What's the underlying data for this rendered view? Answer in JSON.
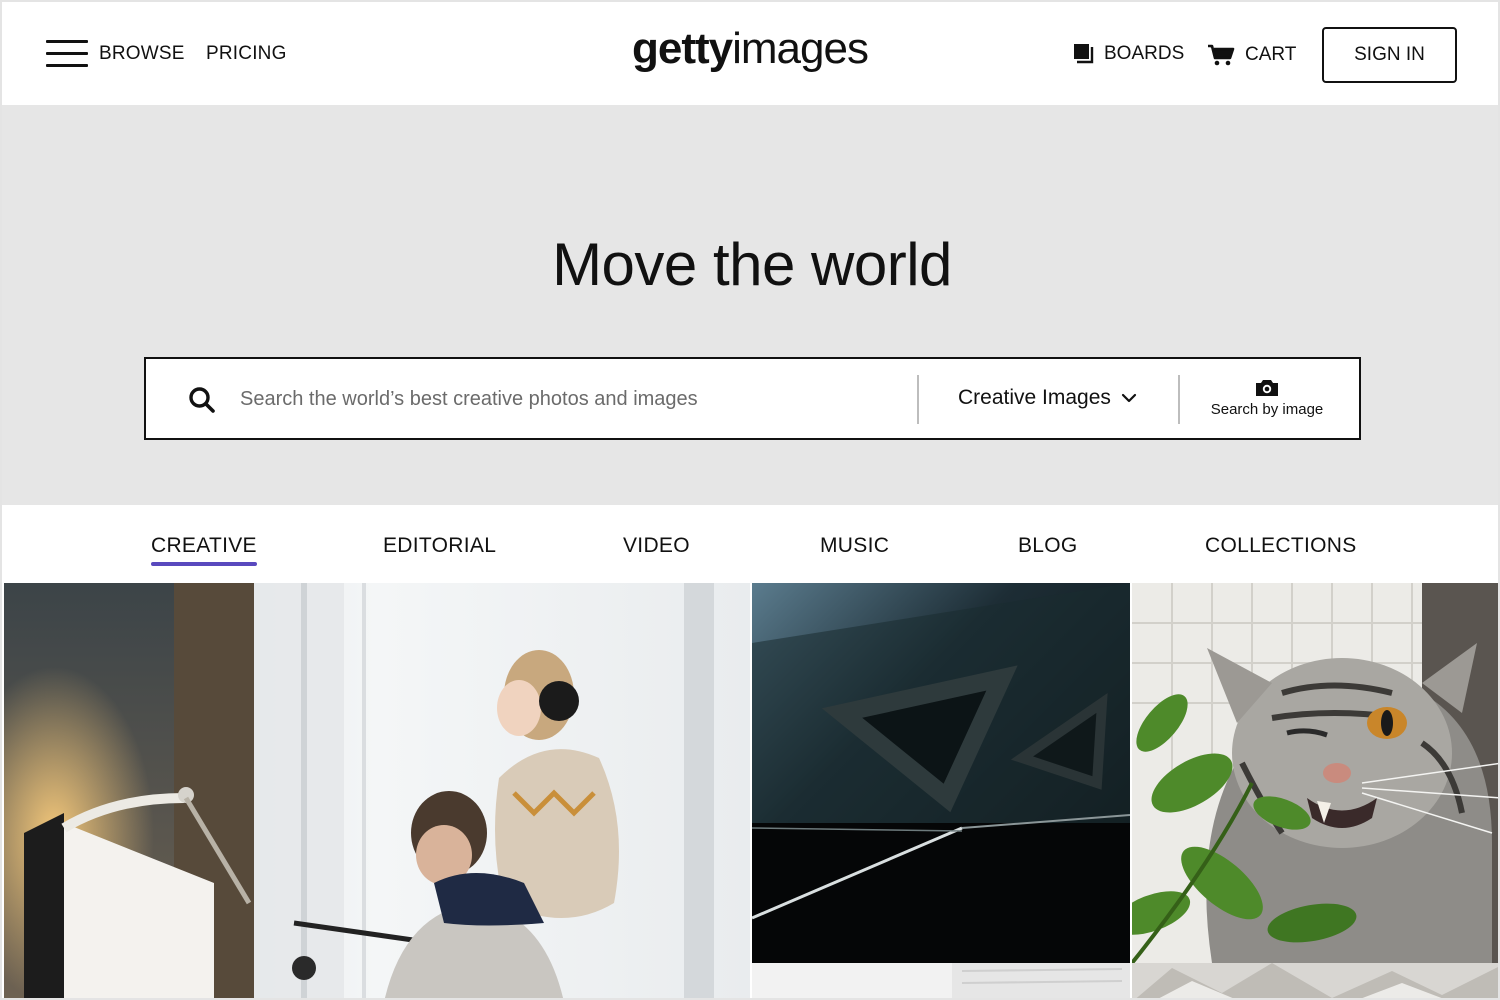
{
  "header": {
    "browse_label": "BROWSE",
    "pricing_label": "PRICING",
    "logo_bold": "getty",
    "logo_light": "images",
    "boards_label": "BOARDS",
    "cart_label": "CART",
    "signin_label": "SIGN IN"
  },
  "hero": {
    "title": "Move the world",
    "search": {
      "placeholder": "Search the world’s best creative photos and images",
      "type_selected": "Creative Images",
      "search_by_image_label": "Search by image"
    }
  },
  "tabs": [
    {
      "label": "CREATIVE",
      "active": true
    },
    {
      "label": "EDITORIAL",
      "active": false
    },
    {
      "label": "VIDEO",
      "active": false
    },
    {
      "label": "MUSIC",
      "active": false
    },
    {
      "label": "BLOG",
      "active": false
    },
    {
      "label": "COLLECTIONS",
      "active": false
    }
  ],
  "icons": {
    "menu": "hamburger-icon",
    "boards": "boards-icon",
    "cart": "cart-icon",
    "search": "search-icon",
    "chevron": "chevron-down-icon",
    "camera": "camera-icon"
  },
  "colors": {
    "hero_bg": "#e6e6e6",
    "active_tab_underline": "#5949be",
    "text": "#111111"
  }
}
